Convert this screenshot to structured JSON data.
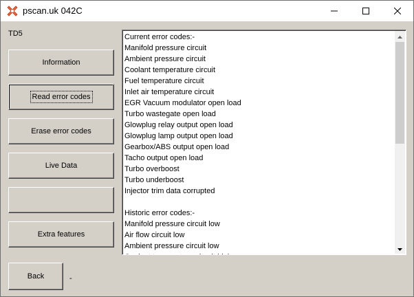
{
  "window": {
    "title": "pscan.uk 042C",
    "icons": {
      "app": "pscan-app-icon",
      "minimize": "minimize-icon",
      "maximize": "maximize-icon",
      "close": "close-icon"
    }
  },
  "ecu_label": "TD5",
  "buttons": {
    "information": "Information",
    "read_error_codes": "Read error codes",
    "erase_error_codes": "Erase error codes",
    "live_data": "Live Data",
    "blank": "",
    "extra_features": "Extra features",
    "back": "Back"
  },
  "status_text": "-",
  "listbox": {
    "lines": [
      "Current error codes:-",
      "Manifold pressure circuit",
      "Ambient pressure circuit",
      "Coolant temperature circuit",
      "Fuel temperature circuit",
      "Inlet air temperature circuit",
      "EGR Vacuum modulator open load",
      "Turbo wastegate open load",
      "Glowplug relay output open load",
      "Glowplug lamp output open load",
      "Gearbox/ABS output open load",
      "Tacho output open load",
      "Turbo overboost",
      "Turbo underboost",
      "Injector trim data corrupted",
      "",
      "Historic error codes:-",
      "Manifold pressure circuit low",
      "Air flow circuit low",
      "Ambient pressure circuit low",
      "Coolant temperature circuit high"
    ]
  },
  "colors": {
    "app_icon": "#e8643c",
    "window_bg": "#d4d0c8"
  }
}
